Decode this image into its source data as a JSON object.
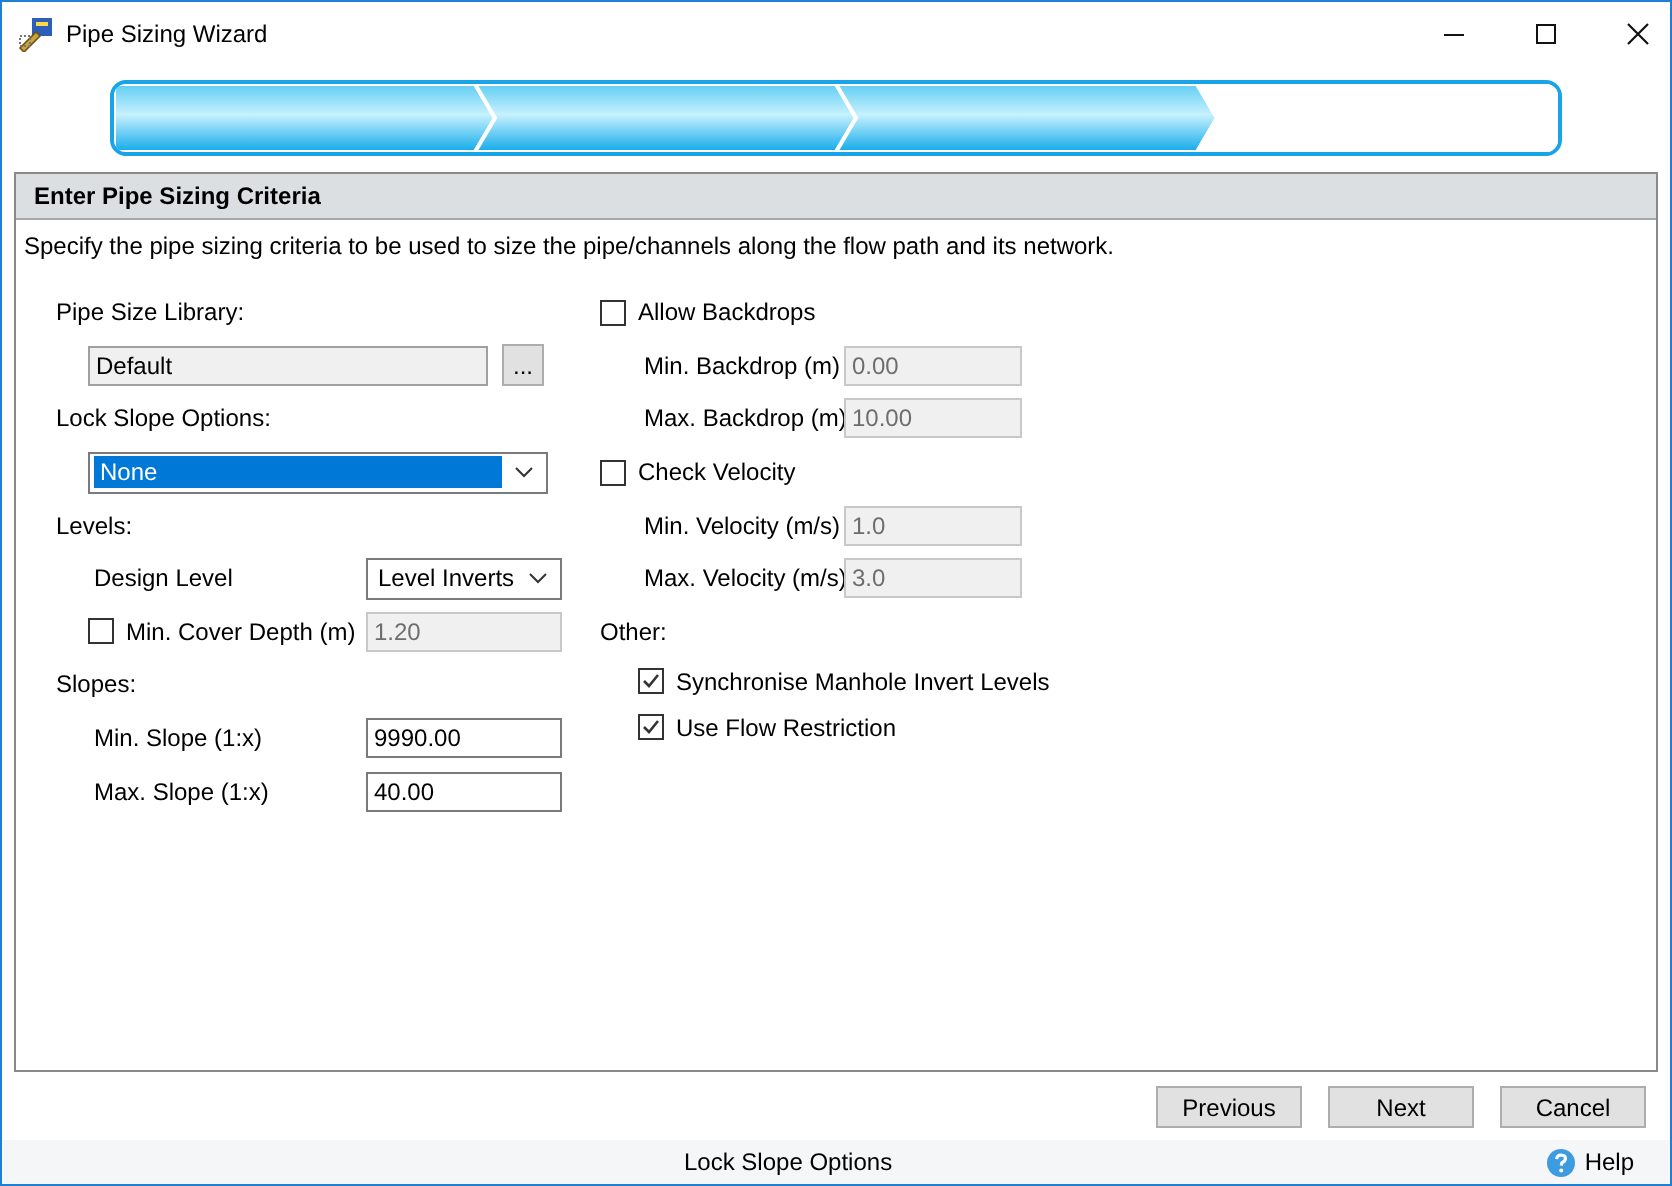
{
  "window": {
    "title": "Pipe Sizing Wizard"
  },
  "progress": {
    "steps": [
      {
        "completed": true
      },
      {
        "completed": true
      },
      {
        "completed": true
      },
      {
        "completed": false
      }
    ]
  },
  "page": {
    "heading": "Enter Pipe Sizing Criteria",
    "description": "Specify the pipe sizing criteria to be used to size the pipe/channels along the flow path and its network."
  },
  "left": [
    {
      "kind": "label",
      "text": "Pipe Size Library:"
    },
    {
      "kind": "browse",
      "value": "Default",
      "button": "..."
    },
    {
      "kind": "label",
      "text": "Lock Slope Options:"
    },
    {
      "kind": "dropdown",
      "value": "None",
      "highlighted": true
    },
    {
      "kind": "label",
      "text": "Levels:"
    },
    {
      "kind": "select_row",
      "label": "Design Level",
      "value": "Level Inverts"
    },
    {
      "kind": "check_field",
      "label": "Min. Cover Depth (m)",
      "checked": false,
      "value": "1.20",
      "disabled": true
    },
    {
      "kind": "label",
      "text": "Slopes:"
    },
    {
      "kind": "field",
      "label": "Min. Slope (1:x)",
      "value": "9990.00",
      "disabled": false
    },
    {
      "kind": "field",
      "label": "Max. Slope (1:x)",
      "value": "40.00",
      "disabled": false
    }
  ],
  "right": [
    {
      "kind": "checkbox",
      "label": "Allow Backdrops",
      "checked": false
    },
    {
      "kind": "field",
      "label": "Min. Backdrop (m)",
      "value": "0.00",
      "disabled": true
    },
    {
      "kind": "field",
      "label": "Max. Backdrop (m)",
      "value": "10.00",
      "disabled": true
    },
    {
      "kind": "checkbox",
      "label": "Check Velocity",
      "checked": false
    },
    {
      "kind": "field",
      "label": "Min. Velocity (m/s)",
      "value": "1.0",
      "disabled": true
    },
    {
      "kind": "field",
      "label": "Max. Velocity (m/s)",
      "value": "3.0",
      "disabled": true
    },
    {
      "kind": "label",
      "text": "Other:"
    },
    {
      "kind": "sub_checkbox",
      "label": "Synchronise Manhole Invert Levels",
      "checked": true
    },
    {
      "kind": "sub_checkbox",
      "label": "Use Flow Restriction",
      "checked": true
    }
  ],
  "buttons": [
    "Previous",
    "Next",
    "Cancel"
  ],
  "status_bar": {
    "text": "Lock Slope Options",
    "help": "Help"
  }
}
